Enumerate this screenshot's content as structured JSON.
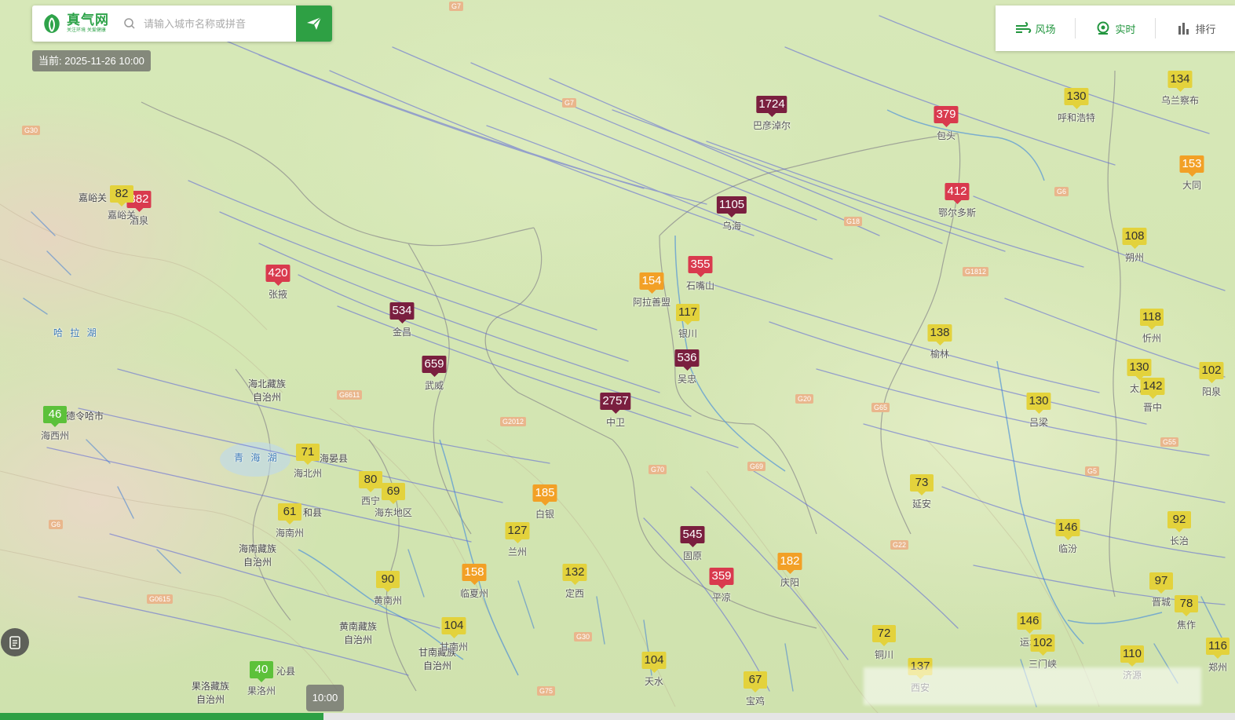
{
  "brand": {
    "name": "真气网",
    "tagline": "关注环境 关爱健康"
  },
  "search": {
    "placeholder": "请输入城市名称或拼音"
  },
  "time_badge": "当前: 2025-11-26 10:00",
  "toolbar": {
    "wind": "风场",
    "live": "实时",
    "rank": "排行"
  },
  "timeline": {
    "handle": "10:00"
  },
  "colors": {
    "good": "#5cc13a",
    "moderate": "#e3d23c",
    "usg": "#f2a026",
    "unhealthy": "#d93a4e",
    "very_unhealthy": "#9c2a57",
    "hazardous": "#7a1f3f",
    "brand": "#2ea044"
  },
  "stations": [
    {
      "value": "1724",
      "level": "haz",
      "name": "巴彦淖尔"
    },
    {
      "value": "379",
      "level": "unh",
      "name": "包头"
    },
    {
      "value": "130",
      "level": "mod",
      "name": "呼和浩特"
    },
    {
      "value": "134",
      "level": "mod",
      "name": "乌兰察布"
    },
    {
      "value": "153",
      "level": "usg",
      "name": "大同"
    },
    {
      "value": "412",
      "level": "unh",
      "name": "鄂尔多斯"
    },
    {
      "value": "1105",
      "level": "haz",
      "name": "乌海"
    },
    {
      "value": "382",
      "level": "unh",
      "name": "酒泉"
    },
    {
      "value": "82",
      "level": "mod",
      "name": "嘉峪关"
    },
    {
      "value": "420",
      "level": "unh",
      "name": "张掖"
    },
    {
      "value": "534",
      "level": "haz",
      "name": "金昌"
    },
    {
      "value": "659",
      "level": "haz",
      "name": "武威"
    },
    {
      "value": "355",
      "level": "unh",
      "name": "石嘴山"
    },
    {
      "value": "154",
      "level": "usg",
      "name": "阿拉善盟"
    },
    {
      "value": "117",
      "level": "mod",
      "name": "银川"
    },
    {
      "value": "536",
      "level": "haz",
      "name": "吴忠"
    },
    {
      "value": "2757",
      "level": "haz",
      "name": "中卫"
    },
    {
      "value": "108",
      "level": "mod",
      "name": "朔州"
    },
    {
      "value": "138",
      "level": "mod",
      "name": "榆林"
    },
    {
      "value": "118",
      "level": "mod",
      "name": "忻州"
    },
    {
      "value": "130",
      "level": "mod",
      "name": "太原"
    },
    {
      "value": "142",
      "level": "mod",
      "name": "晋中"
    },
    {
      "value": "102",
      "level": "mod",
      "name": "阳泉"
    },
    {
      "value": "130",
      "level": "mod",
      "name": "吕梁"
    },
    {
      "value": "46",
      "level": "good",
      "name": "海西州"
    },
    {
      "value": "71",
      "level": "mod",
      "name": "海北州"
    },
    {
      "value": "80",
      "level": "mod",
      "name": "西宁"
    },
    {
      "value": "69",
      "level": "mod",
      "name": "海东地区"
    },
    {
      "value": "61",
      "level": "mod",
      "name": "海南州"
    },
    {
      "value": "185",
      "level": "usg",
      "name": "白银"
    },
    {
      "value": "127",
      "level": "mod",
      "name": "兰州"
    },
    {
      "value": "73",
      "level": "mod",
      "name": "延安"
    },
    {
      "value": "545",
      "level": "haz",
      "name": "固原"
    },
    {
      "value": "182",
      "level": "usg",
      "name": "庆阳"
    },
    {
      "value": "146",
      "level": "mod",
      "name": "临汾"
    },
    {
      "value": "92",
      "level": "mod",
      "name": "长治"
    },
    {
      "value": "90",
      "level": "mod",
      "name": "黄南州"
    },
    {
      "value": "158",
      "level": "usg",
      "name": "临夏州"
    },
    {
      "value": "132",
      "level": "mod",
      "name": "定西"
    },
    {
      "value": "359",
      "level": "unh",
      "name": "平凉"
    },
    {
      "value": "97",
      "level": "mod",
      "name": "晋城"
    },
    {
      "value": "78",
      "level": "mod",
      "name": "焦作"
    },
    {
      "value": "146",
      "level": "mod",
      "name": "运城"
    },
    {
      "value": "104",
      "level": "mod",
      "name": "甘南州"
    },
    {
      "value": "72",
      "level": "mod",
      "name": "铜川"
    },
    {
      "value": "102",
      "level": "mod",
      "name": "三门峡"
    },
    {
      "value": "110",
      "level": "mod",
      "name": "济源"
    },
    {
      "value": "116",
      "level": "mod",
      "name": "郑州"
    },
    {
      "value": "104",
      "level": "mod",
      "name": "天水"
    },
    {
      "value": "67",
      "level": "mod",
      "name": "宝鸡"
    },
    {
      "value": "137",
      "level": "mod",
      "name": "西安"
    },
    {
      "value": "40",
      "level": "good",
      "name": "果洛州"
    }
  ],
  "labels": {
    "hala": "哈 拉 湖",
    "qinghai_lake": "青 海 湖",
    "haibei": "海北藏族\n自治州",
    "hainan": "海南藏族\n自治州",
    "huangnan": "黄南藏族\n自治州",
    "gannan": "甘南藏族\n自治州",
    "guoluo": "果洛藏族\n自治州",
    "delingha": "德令哈市",
    "haiyan": "海晏县",
    "guide": "和县",
    "jiayuguan": "嘉峪关",
    "maqin": "沁县"
  },
  "roads": [
    "G7",
    "G30",
    "G7",
    "G6",
    "G18",
    "G69",
    "G20",
    "G65",
    "G70",
    "G22",
    "G30",
    "G6",
    "G75",
    "G55",
    "G0615",
    "G6611",
    "G2012",
    "G1812",
    "G5"
  ]
}
